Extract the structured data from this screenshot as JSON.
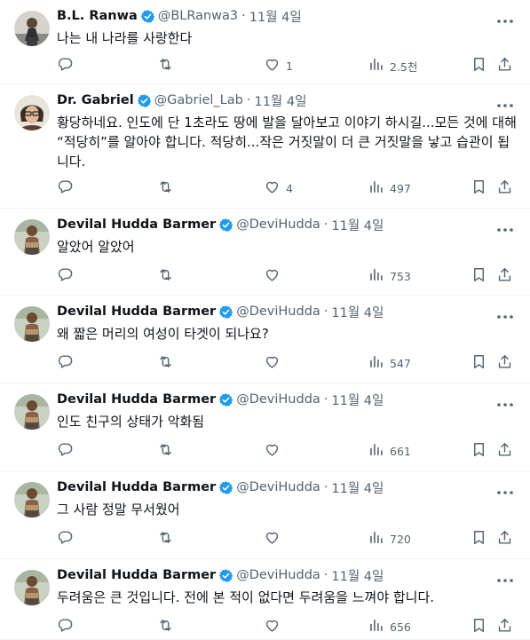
{
  "tweets": [
    {
      "name": "B.L. Ranwa",
      "handle": "@BLRanwa3",
      "time": "11월 4일",
      "text": "나는 내 나라를 사랑한다",
      "reply": "",
      "retweet": "",
      "like": "1",
      "views": "2.5천",
      "avatar": "av1"
    },
    {
      "name": "Dr. Gabriel",
      "handle": "@Gabriel_Lab",
      "time": "11월 4일",
      "text": "황당하네요. 인도에 단 1초라도 땅에 발을 달아보고 이야기 하시길...모든 것에 대해 “적당히”를 알아야 합니다. 적당히...작은 거짓말이 더 큰 거짓말을 낳고 습관이 됩니다.",
      "reply": "",
      "retweet": "",
      "like": "4",
      "views": "497",
      "avatar": "av2"
    },
    {
      "name": "Devilal Hudda Barmer",
      "handle": "@DeviHudda",
      "time": "11월 4일",
      "text": "알았어 알았어",
      "reply": "",
      "retweet": "",
      "like": "",
      "views": "753",
      "avatar": "av3"
    },
    {
      "name": "Devilal Hudda Barmer",
      "handle": "@DeviHudda",
      "time": "11월 4일",
      "text": "왜 짧은 머리의 여성이 타겟이 되나요?",
      "reply": "",
      "retweet": "",
      "like": "",
      "views": "547",
      "avatar": "av3"
    },
    {
      "name": "Devilal Hudda Barmer",
      "handle": "@DeviHudda",
      "time": "11월 4일",
      "text": "인도 친구의 상태가 악화됨",
      "reply": "",
      "retweet": "",
      "like": "",
      "views": "661",
      "avatar": "av3"
    },
    {
      "name": "Devilal Hudda Barmer",
      "handle": "@DeviHudda",
      "time": "11월 4일",
      "text": "그 사람 정말 무서웠어",
      "reply": "",
      "retweet": "",
      "like": "",
      "views": "720",
      "avatar": "av3"
    },
    {
      "name": "Devilal Hudda Barmer",
      "handle": "@DeviHudda",
      "time": "11월 4일",
      "text": "두려움은 큰 것입니다. 전에 본 적이 없다면 두려움을 느껴야 합니다.",
      "reply": "",
      "retweet": "",
      "like": "",
      "views": "656",
      "avatar": "av3"
    }
  ],
  "icons": {
    "reply": "reply-icon",
    "retweet": "retweet-icon",
    "like": "like-icon",
    "views": "views-icon",
    "bookmark": "bookmark-icon",
    "share": "share-icon",
    "verified": "verified-badge-icon",
    "more": "more-icon"
  },
  "colors": {
    "text": "#0f1419",
    "muted": "#536471",
    "verified": "#1d9bf0",
    "divider": "#eff3f4"
  }
}
